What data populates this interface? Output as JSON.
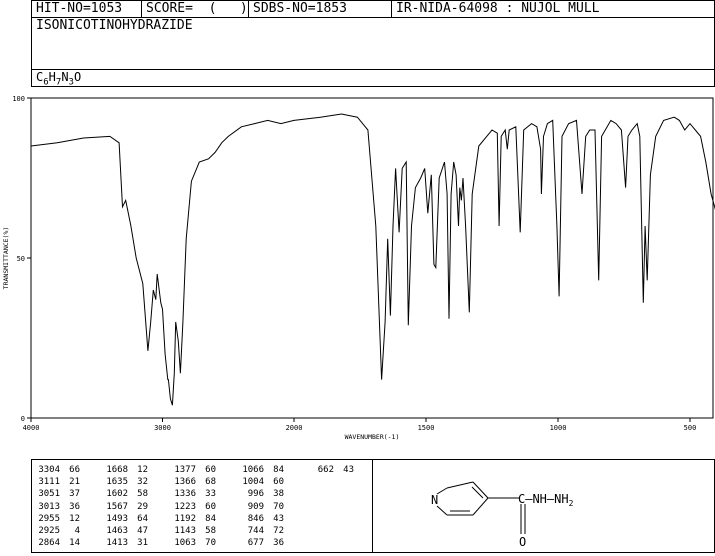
{
  "header": {
    "hit_no": "HIT-NO=1053",
    "score": "SCORE=  (   )",
    "sdbs_no": "SDBS-NO=1853",
    "ir_code": "IR-NIDA-64098 : NUJOL MULL",
    "compound": "ISONICOTINOHYDRAZIDE",
    "formula": {
      "c": "C",
      "c_n": "6",
      "h": "H",
      "h_n": "7",
      "n": "N",
      "n_n": "3",
      "o": "O"
    }
  },
  "chart_data": {
    "type": "line",
    "xlabel": "WAVENUMBER(-1)",
    "ylabel": "TRANSMITTANCE(%)",
    "xlim": [
      4000,
      400
    ],
    "ylim": [
      0,
      100
    ],
    "x_ticks": [
      4000,
      3000,
      2000,
      1500,
      1000,
      500
    ],
    "y_ticks": [
      0,
      50,
      100
    ],
    "spectrum": [
      [
        4000,
        85
      ],
      [
        3800,
        86
      ],
      [
        3600,
        87.5
      ],
      [
        3400,
        88
      ],
      [
        3330,
        86
      ],
      [
        3304,
        66
      ],
      [
        3280,
        68
      ],
      [
        3240,
        60
      ],
      [
        3200,
        50
      ],
      [
        3150,
        42
      ],
      [
        3111,
        21
      ],
      [
        3090,
        30
      ],
      [
        3070,
        40
      ],
      [
        3051,
        37
      ],
      [
        3040,
        45
      ],
      [
        3013,
        36
      ],
      [
        3000,
        34
      ],
      [
        2980,
        20
      ],
      [
        2960,
        12
      ],
      [
        2955,
        12
      ],
      [
        2940,
        6
      ],
      [
        2925,
        4
      ],
      [
        2910,
        14
      ],
      [
        2900,
        30
      ],
      [
        2880,
        24
      ],
      [
        2864,
        14
      ],
      [
        2845,
        30
      ],
      [
        2820,
        56
      ],
      [
        2780,
        74
      ],
      [
        2720,
        80
      ],
      [
        2650,
        81
      ],
      [
        2600,
        83
      ],
      [
        2550,
        86
      ],
      [
        2500,
        88
      ],
      [
        2400,
        91
      ],
      [
        2300,
        92
      ],
      [
        2200,
        93
      ],
      [
        2100,
        92
      ],
      [
        2000,
        93
      ],
      [
        1900,
        94
      ],
      [
        1820,
        95
      ],
      [
        1760,
        94
      ],
      [
        1720,
        90
      ],
      [
        1690,
        60
      ],
      [
        1668,
        12
      ],
      [
        1655,
        30
      ],
      [
        1645,
        56
      ],
      [
        1635,
        32
      ],
      [
        1625,
        60
      ],
      [
        1615,
        78
      ],
      [
        1602,
        58
      ],
      [
        1590,
        78
      ],
      [
        1575,
        80
      ],
      [
        1567,
        29
      ],
      [
        1555,
        60
      ],
      [
        1540,
        72
      ],
      [
        1520,
        75
      ],
      [
        1505,
        78
      ],
      [
        1493,
        64
      ],
      [
        1480,
        76
      ],
      [
        1470,
        48
      ],
      [
        1463,
        47
      ],
      [
        1450,
        75
      ],
      [
        1430,
        80
      ],
      [
        1420,
        70
      ],
      [
        1413,
        31
      ],
      [
        1405,
        70
      ],
      [
        1395,
        80
      ],
      [
        1386,
        76
      ],
      [
        1377,
        60
      ],
      [
        1372,
        72
      ],
      [
        1366,
        68
      ],
      [
        1360,
        75
      ],
      [
        1350,
        60
      ],
      [
        1336,
        33
      ],
      [
        1325,
        70
      ],
      [
        1300,
        85
      ],
      [
        1270,
        88
      ],
      [
        1250,
        90
      ],
      [
        1230,
        89
      ],
      [
        1223,
        60
      ],
      [
        1215,
        88
      ],
      [
        1200,
        90
      ],
      [
        1192,
        84
      ],
      [
        1185,
        90
      ],
      [
        1160,
        91
      ],
      [
        1143,
        58
      ],
      [
        1130,
        90
      ],
      [
        1100,
        92
      ],
      [
        1080,
        91
      ],
      [
        1066,
        84
      ],
      [
        1063,
        70
      ],
      [
        1055,
        88
      ],
      [
        1040,
        92
      ],
      [
        1020,
        93
      ],
      [
        1004,
        60
      ],
      [
        996,
        38
      ],
      [
        985,
        88
      ],
      [
        960,
        92
      ],
      [
        930,
        93
      ],
      [
        909,
        70
      ],
      [
        895,
        88
      ],
      [
        880,
        90
      ],
      [
        860,
        90
      ],
      [
        846,
        43
      ],
      [
        835,
        88
      ],
      [
        800,
        93
      ],
      [
        780,
        92
      ],
      [
        760,
        90
      ],
      [
        744,
        72
      ],
      [
        735,
        88
      ],
      [
        720,
        90
      ],
      [
        700,
        92
      ],
      [
        690,
        88
      ],
      [
        677,
        36
      ],
      [
        670,
        60
      ],
      [
        662,
        43
      ],
      [
        650,
        76
      ],
      [
        630,
        88
      ],
      [
        600,
        93
      ],
      [
        560,
        94
      ],
      [
        540,
        93
      ],
      [
        520,
        90
      ],
      [
        500,
        92
      ],
      [
        480,
        90
      ],
      [
        460,
        88
      ],
      [
        440,
        80
      ],
      [
        420,
        70
      ],
      [
        400,
        64
      ]
    ],
    "peak_table": [
      [
        3304,
        66
      ],
      [
        3111,
        21
      ],
      [
        3051,
        37
      ],
      [
        3013,
        36
      ],
      [
        2955,
        12
      ],
      [
        2925,
        4
      ],
      [
        2864,
        14
      ],
      [
        1668,
        12
      ],
      [
        1635,
        32
      ],
      [
        1602,
        58
      ],
      [
        1567,
        29
      ],
      [
        1493,
        64
      ],
      [
        1463,
        47
      ],
      [
        1413,
        31
      ],
      [
        1377,
        60
      ],
      [
        1366,
        68
      ],
      [
        1336,
        33
      ],
      [
        1223,
        60
      ],
      [
        1192,
        84
      ],
      [
        1143,
        58
      ],
      [
        1063,
        70
      ],
      [
        1066,
        84
      ],
      [
        1004,
        60
      ],
      [
        996,
        38
      ],
      [
        909,
        70
      ],
      [
        846,
        43
      ],
      [
        744,
        72
      ],
      [
        677,
        36
      ],
      [
        662,
        43
      ]
    ]
  },
  "structure": {
    "ring_atom": "N",
    "chain": "C—NH—NH",
    "chain_sub": "2",
    "carbonyl_atom": "O"
  }
}
